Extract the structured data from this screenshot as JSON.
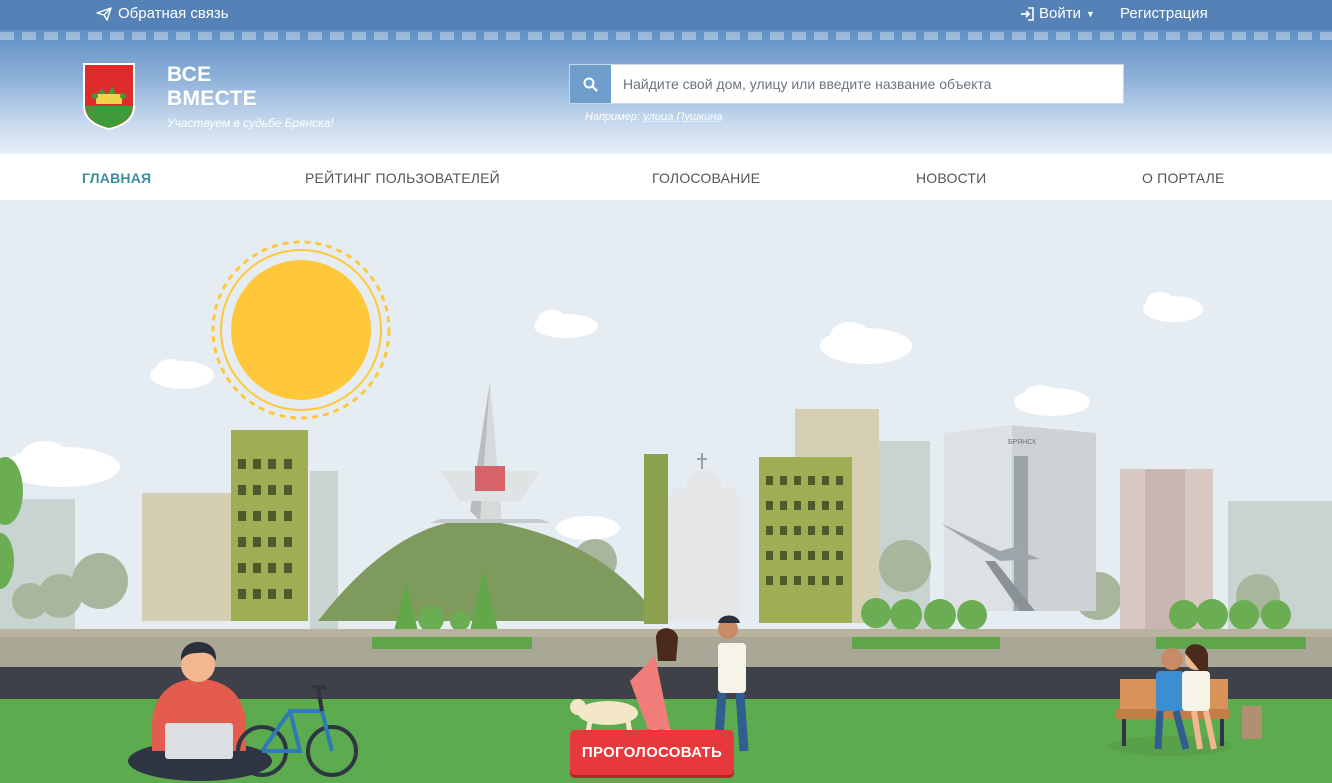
{
  "topbar": {
    "feedback_label": "Обратная связь",
    "login_label": "Войти",
    "register_label": "Регистрация"
  },
  "header": {
    "title_line1": "ВСЕ",
    "title_line2": "ВМЕСТЕ",
    "subtitle": "Участвуем в судьбе Брянска!",
    "search_placeholder": "Найдите свой дом, улицу или введите название объекта",
    "search_example_prefix": "Например:",
    "search_example_value": "улица Пушкина"
  },
  "nav": {
    "items": [
      {
        "label": "ГЛАВНАЯ",
        "active": true
      },
      {
        "label": "РЕЙТИНГ ПОЛЬЗОВАТЕЛЕЙ",
        "active": false
      },
      {
        "label": "ГОЛОСОВАНИЕ",
        "active": false
      },
      {
        "label": "НОВОСТИ",
        "active": false
      },
      {
        "label": "О ПОРТАЛЕ",
        "active": false
      }
    ]
  },
  "hero": {
    "vote_button_label": "ПРОГОЛОСОВАТЬ",
    "building_sign": "БРЯНСК"
  },
  "colors": {
    "topbar": "#5482b6",
    "nav_active": "#3a8fa0",
    "vote_button": "#e8383b",
    "sun": "#ffc83a",
    "grass": "#5cab4f",
    "road": "#3e4148"
  }
}
